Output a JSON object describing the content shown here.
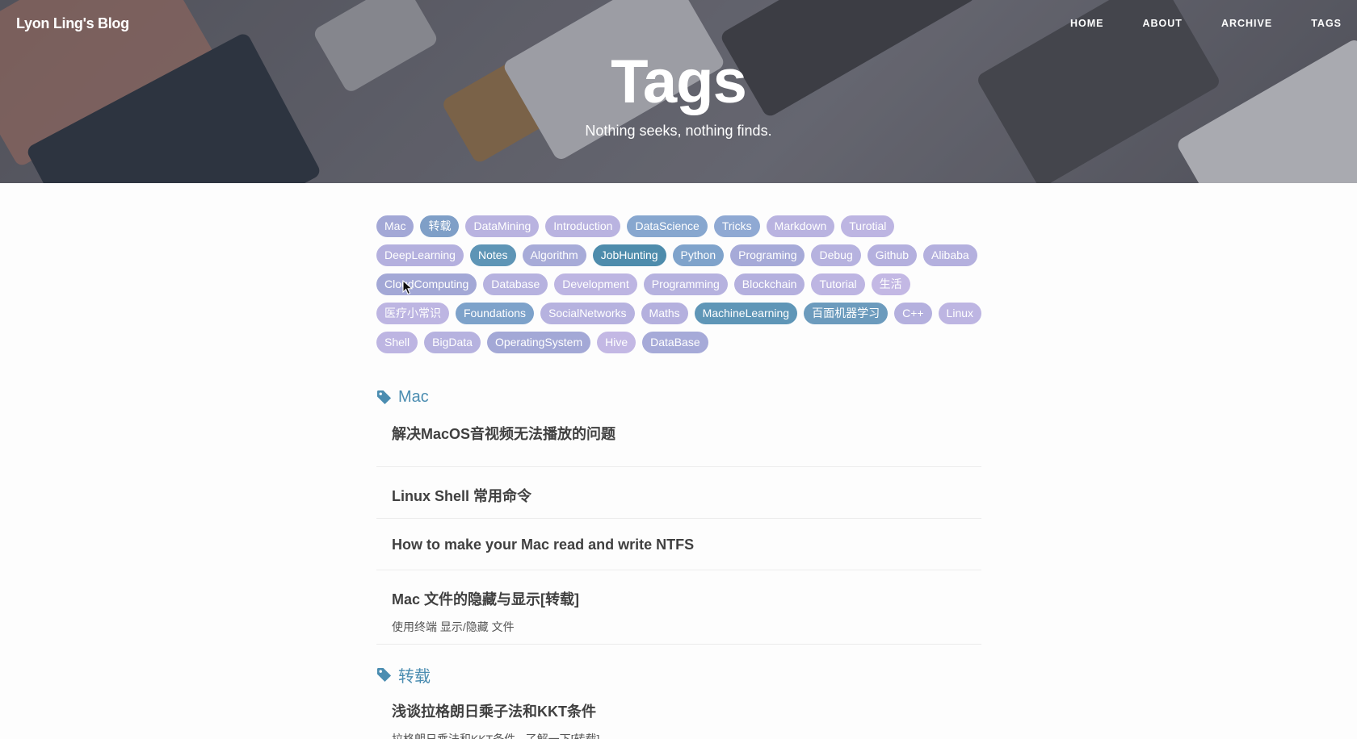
{
  "site": {
    "brand": "Lyon Ling's Blog",
    "nav": [
      "HOME",
      "ABOUT",
      "ARCHIVE",
      "TAGS"
    ],
    "hero_title": "Tags",
    "hero_subtitle": "Nothing seeks, nothing finds."
  },
  "tag_rows": [
    [
      {
        "label": "Mac",
        "color": "#a3a8d6"
      },
      {
        "label": "转载",
        "color": "#7f9fc7"
      },
      {
        "label": "DataMining",
        "color": "#b9b3e0"
      },
      {
        "label": "Introduction",
        "color": "#b9b3e0"
      },
      {
        "label": "DataScience",
        "color": "#87a7cf"
      },
      {
        "label": "Tricks",
        "color": "#8fa9d3"
      },
      {
        "label": "Markdown",
        "color": "#b9b3e0"
      },
      {
        "label": "Turotial",
        "color": "#bdb5e2"
      }
    ],
    [
      {
        "label": "DeepLearning",
        "color": "#b4b0de"
      },
      {
        "label": "Notes",
        "color": "#5e95b6"
      },
      {
        "label": "Algorithm",
        "color": "#a7abd8"
      },
      {
        "label": "JobHunting",
        "color": "#4e8cac"
      },
      {
        "label": "Python",
        "color": "#7fa3cb"
      },
      {
        "label": "Programing",
        "color": "#a6aad8"
      },
      {
        "label": "Debug",
        "color": "#b6b2df"
      },
      {
        "label": "Github",
        "color": "#b4b0de"
      },
      {
        "label": "Alibaba",
        "color": "#b4b0de"
      }
    ],
    [
      {
        "label": "CloudComputing",
        "color": "#a3a8d6"
      },
      {
        "label": "Database",
        "color": "#b6b2df"
      },
      {
        "label": "Development",
        "color": "#bdb5e2"
      },
      {
        "label": "Programming",
        "color": "#b6b2df"
      },
      {
        "label": "Blockchain",
        "color": "#b4b0de"
      },
      {
        "label": "Tutorial",
        "color": "#bdb5e2"
      },
      {
        "label": "生活",
        "color": "#c3b8e4"
      }
    ],
    [
      {
        "label": "医疗小常识",
        "color": "#bdb5e2"
      },
      {
        "label": "Foundations",
        "color": "#7da2ca"
      },
      {
        "label": "SocialNetworks",
        "color": "#b6b2df"
      },
      {
        "label": "Maths",
        "color": "#b4b0de"
      },
      {
        "label": "MachineLearning",
        "color": "#5f96b7"
      },
      {
        "label": "百面机器学习",
        "color": "#6c9bbd"
      },
      {
        "label": "C++",
        "color": "#b4b0de"
      },
      {
        "label": "Linux",
        "color": "#bdb5e2"
      }
    ],
    [
      {
        "label": "Shell",
        "color": "#bdb5e2"
      },
      {
        "label": "BigData",
        "color": "#b6b2df"
      },
      {
        "label": "OperatingSystem",
        "color": "#a3a8d6"
      },
      {
        "label": "Hive",
        "color": "#c3b8e4"
      },
      {
        "label": "DataBase",
        "color": "#a6aad8"
      }
    ]
  ],
  "sections": [
    {
      "title": "Mac",
      "posts": [
        {
          "title": "解决MacOS音视频无法播放的问题"
        },
        {
          "title": "Linux Shell 常用命令"
        },
        {
          "title": "How to make your Mac read and write NTFS"
        },
        {
          "title": "Mac 文件的隐藏与显示[转载]",
          "subtitle": "使用终端 显示/隐藏 文件"
        }
      ]
    },
    {
      "title": "转载",
      "posts": [
        {
          "title": "浅谈拉格朗日乘子法和KKT条件",
          "subtitle": "拉格朗日乘法和KKT条件 - 了解一下[转载]"
        }
      ]
    }
  ],
  "icons": {
    "section_tag": "tag-icon",
    "cursor": "mouse-pointer-icon"
  },
  "colors": {
    "accent": "#4b8db1",
    "tag_dark": "#4e8cac"
  }
}
